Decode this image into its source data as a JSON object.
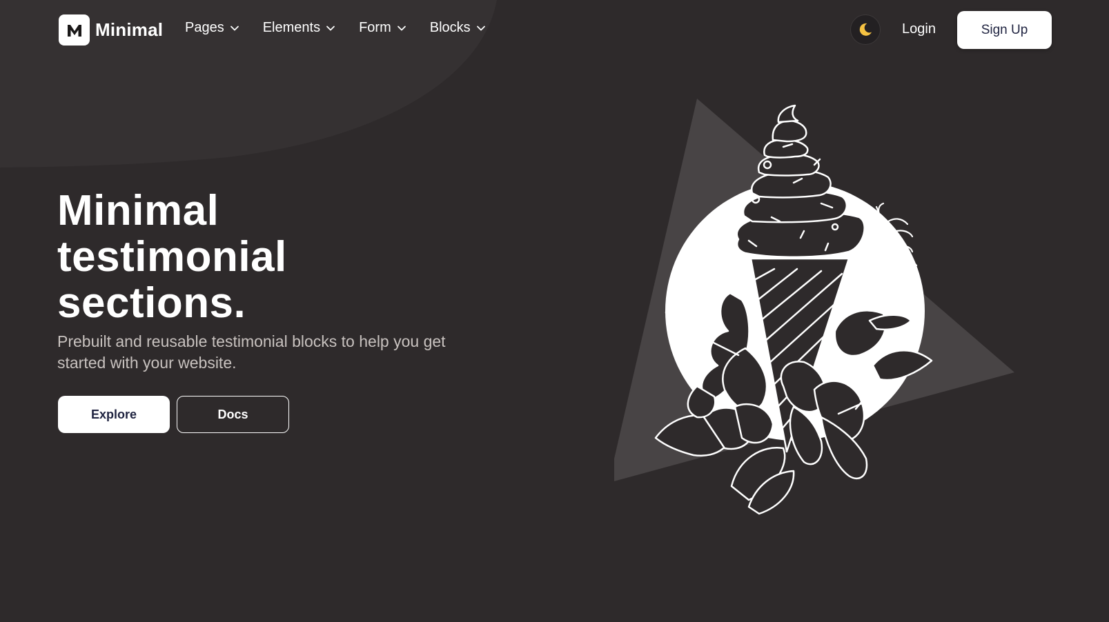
{
  "brand": {
    "logo_letter": "M",
    "name": "Minimal"
  },
  "nav": {
    "items": [
      {
        "label": "Pages"
      },
      {
        "label": "Elements"
      },
      {
        "label": "Form"
      },
      {
        "label": "Blocks"
      }
    ]
  },
  "header": {
    "theme_icon": "moon-icon",
    "login_label": "Login",
    "signup_label": "Sign Up"
  },
  "hero": {
    "title_line1": "Minimal",
    "title_line2": "testimonial",
    "title_line3": "sections.",
    "subtitle": "Prebuilt and reusable testimonial blocks to help you get started with your website.",
    "explore_label": "Explore",
    "docs_label": "Docs"
  },
  "illustration": {
    "icon": "ice-cream-cone-with-flowers-illustration"
  },
  "colors": {
    "background": "#2e2a2b",
    "accent_moon": "#f5c242",
    "button_text": "#1f2340"
  }
}
